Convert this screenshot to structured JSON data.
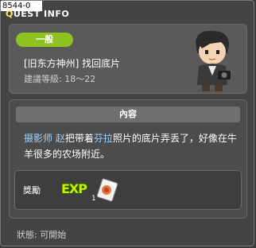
{
  "window": {
    "id_tag": "8544-0",
    "title_prefix": "Q",
    "title_rest": "UEST INFO"
  },
  "quest": {
    "category": "一般",
    "name": "[旧东方神州] 找回底片",
    "level_range": "建議等級: 18～22"
  },
  "description": {
    "header": "內容",
    "npc1": "摄影师 赵",
    "text1": "把带着",
    "npc2": "芬拉",
    "text2": "照片的底片弄丢了，好像在牛羊很多的农场附近。"
  },
  "reward": {
    "label": "獎勵",
    "exp_label": "EXP",
    "item_count": "1"
  },
  "status": {
    "text": "狀態: 可開始"
  },
  "colors": {
    "badge_green": "#8dc21f",
    "highlight_blue": "#9fd3ff",
    "title_yellow": "#ffe66a"
  }
}
